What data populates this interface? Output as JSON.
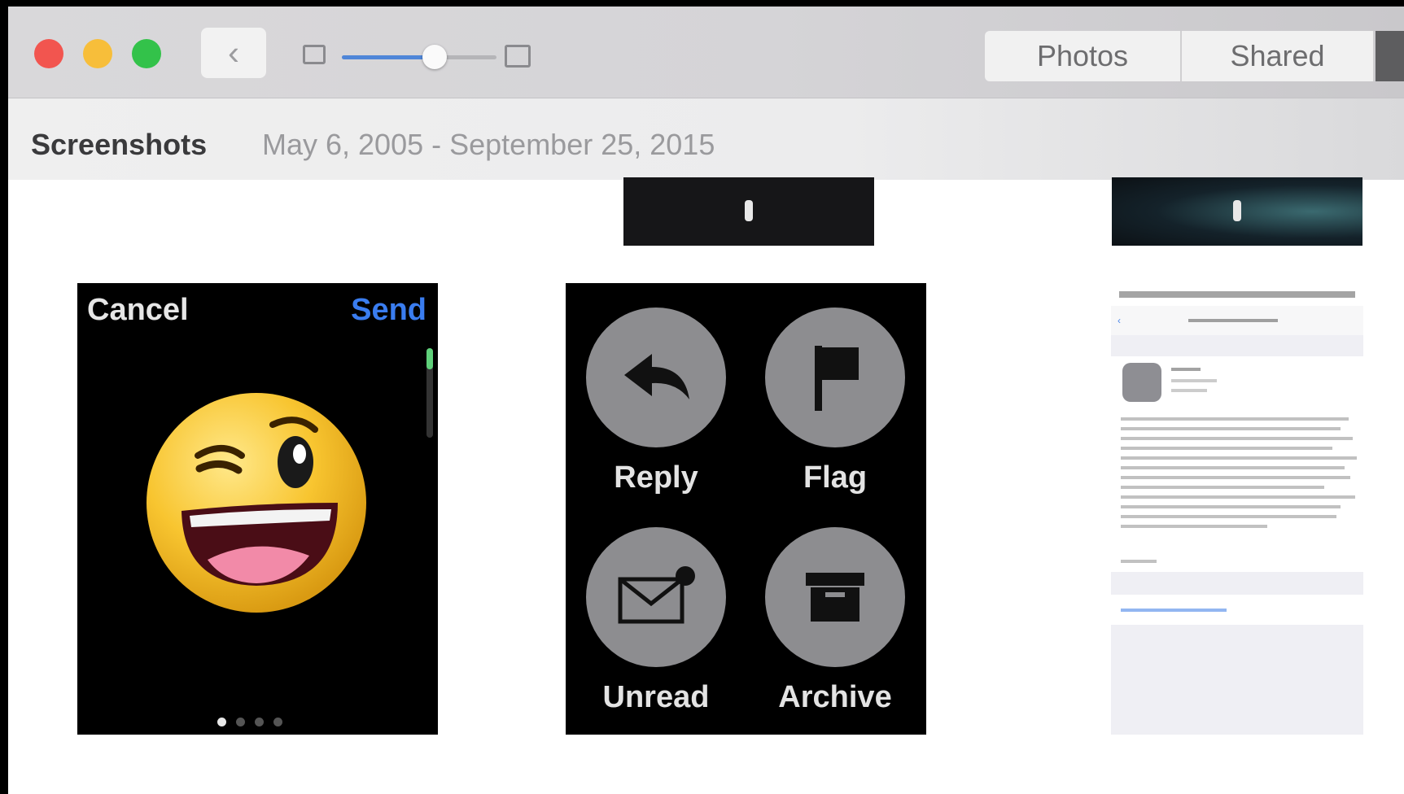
{
  "toolbar": {
    "back_glyph": "‹",
    "tabs": [
      {
        "label": "Photos"
      },
      {
        "label": "Shared"
      }
    ],
    "zoom_slider": {
      "value_fraction": 0.6
    }
  },
  "subheader": {
    "album_title": "Screenshots",
    "date_range": "May 6, 2005 - September 25, 2015"
  },
  "thumbnails": {
    "emoji_screen": {
      "cancel_label": "Cancel",
      "send_label": "Send",
      "page_dots": 4,
      "active_dot": 1
    },
    "mail_actions": [
      {
        "label": "Reply",
        "icon": "reply-arrow-icon"
      },
      {
        "label": "Flag",
        "icon": "flag-icon"
      },
      {
        "label": "Unread",
        "icon": "envelope-unread-icon"
      },
      {
        "label": "Archive",
        "icon": "archive-box-icon"
      }
    ]
  },
  "colors": {
    "close": "#f2554f",
    "minimize": "#f7be3a",
    "zoom": "#33c24a",
    "slider_accent": "#4f86d8",
    "send_blue": "#3a7df0"
  }
}
